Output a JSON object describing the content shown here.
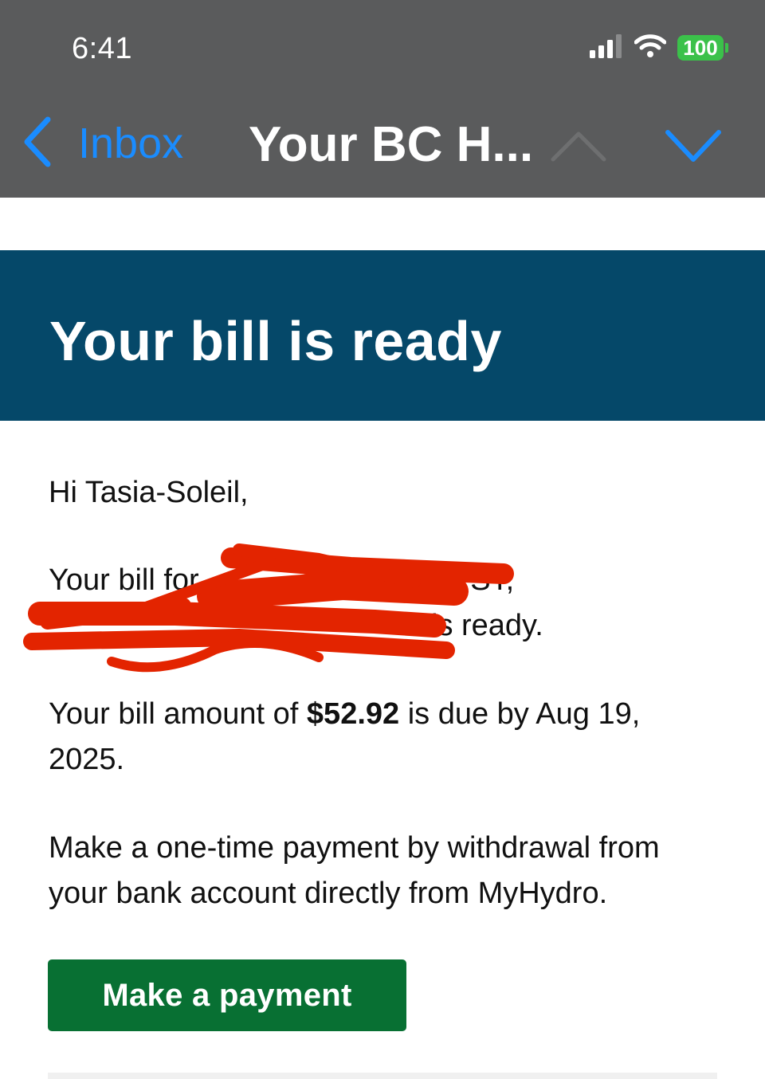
{
  "status_bar": {
    "time": "6:41",
    "battery": "100",
    "icons": [
      "cellular-signal-icon",
      "wifi-icon",
      "battery-icon"
    ]
  },
  "nav": {
    "back_icon": "chevron-left-icon",
    "back_label": "Inbox",
    "title": "Your BC H...",
    "prev_icon": "chevron-up-icon",
    "next_icon": "chevron-down-icon"
  },
  "email": {
    "banner_title": "Your bill is ready",
    "greeting": "Hi Tasia-Soleil,",
    "bill_for_prefix": "Your bill for ",
    "bill_for_visible_1": "ST,",
    "bill_for_visible_2": "is ready.",
    "amount_prefix": "Your bill amount of ",
    "amount": "$52.92",
    "amount_suffix": " is due by Aug 19, 2025.",
    "payment_info": "Make a one-time payment by withdrawal from your bank account directly from MyHydro.",
    "pay_button_label": "Make a payment"
  },
  "colors": {
    "nav_background": "#5a5b5c",
    "accent_blue": "#1a8cff",
    "banner_background": "#054869",
    "button_green": "#087033",
    "battery_green": "#3bc14a",
    "redaction_red": "#e32400"
  }
}
